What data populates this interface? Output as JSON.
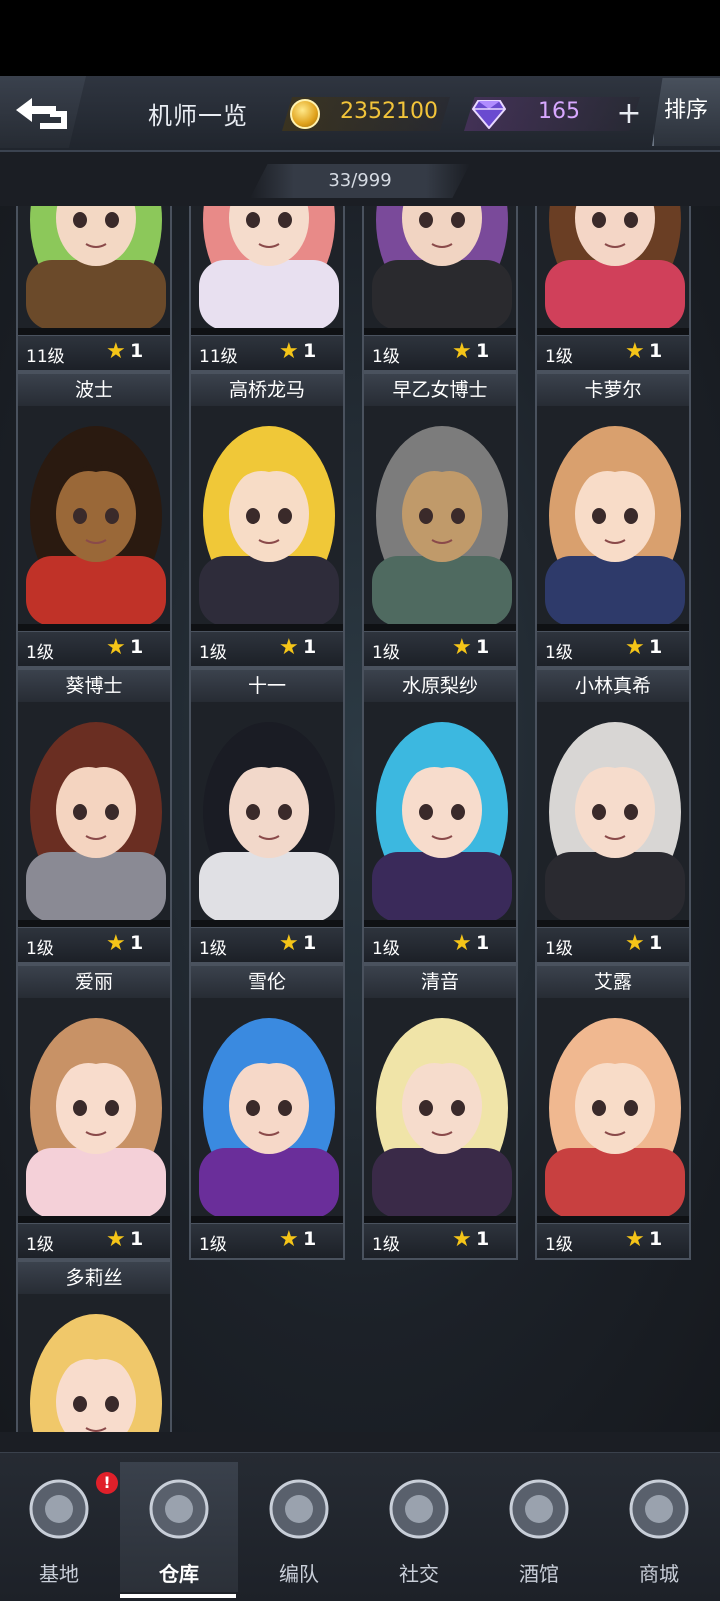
{
  "header": {
    "title": "机师一览",
    "coins": "2352100",
    "gems": "165",
    "plus": "+",
    "sort_label": "排序",
    "count": "33/999"
  },
  "cards": [
    {
      "name": "",
      "level": "11级",
      "stars": "1",
      "palette": [
        "#8cc85a",
        "#f3d8c4",
        "#6b4a2a"
      ]
    },
    {
      "name": "",
      "level": "11级",
      "stars": "1",
      "palette": [
        "#e88a88",
        "#f5dccc",
        "#e8e0f0"
      ]
    },
    {
      "name": "",
      "level": "1级",
      "stars": "1",
      "palette": [
        "#7a4a9a",
        "#f1d4c2",
        "#2a2a2e"
      ]
    },
    {
      "name": "",
      "level": "1级",
      "stars": "1",
      "palette": [
        "#6a3e24",
        "#f4d6c6",
        "#d0405a"
      ]
    },
    {
      "name": "波士",
      "level": "1级",
      "stars": "1",
      "palette": [
        "#2a1a10",
        "#9a6838",
        "#c03228"
      ]
    },
    {
      "name": "高桥龙马",
      "level": "1级",
      "stars": "1",
      "palette": [
        "#f0c838",
        "#f7dcc6",
        "#2e2c3a"
      ]
    },
    {
      "name": "早乙女博士",
      "level": "1级",
      "stars": "1",
      "palette": [
        "#7c7c7c",
        "#c09a6a",
        "#4f6a60"
      ]
    },
    {
      "name": "卡萝尔",
      "level": "1级",
      "stars": "1",
      "palette": [
        "#d9a06e",
        "#f8dcc8",
        "#2e3a6a"
      ]
    },
    {
      "name": "葵博士",
      "level": "1级",
      "stars": "1",
      "palette": [
        "#6a2e22",
        "#f4d4c0",
        "#8a8a94"
      ]
    },
    {
      "name": "十一",
      "level": "1级",
      "stars": "1",
      "palette": [
        "#1a1c24",
        "#f2d8ca",
        "#e0e0e4"
      ]
    },
    {
      "name": "水原梨纱",
      "level": "1级",
      "stars": "1",
      "palette": [
        "#3cb8e0",
        "#f7dccc",
        "#3a2a5a"
      ]
    },
    {
      "name": "小林真希",
      "level": "1级",
      "stars": "1",
      "palette": [
        "#d8d6d4",
        "#f6dccc",
        "#2a2a30"
      ]
    },
    {
      "name": "爱丽",
      "level": "1级",
      "stars": "1",
      "palette": [
        "#c89266",
        "#f8dccc",
        "#f4d0d8"
      ]
    },
    {
      "name": "雪伦",
      "level": "1级",
      "stars": "1",
      "palette": [
        "#3a8ae0",
        "#f6d8c8",
        "#6a2e9a"
      ]
    },
    {
      "name": "清音",
      "level": "1级",
      "stars": "1",
      "palette": [
        "#f0e4a8",
        "#f6dccc",
        "#3a2a48"
      ]
    },
    {
      "name": "艾露",
      "level": "1级",
      "stars": "1",
      "palette": [
        "#f0b890",
        "#f8dcc8",
        "#c84040"
      ]
    },
    {
      "name": "多莉丝",
      "level": "",
      "stars": "",
      "palette": [
        "#f0c86a",
        "#f8dccc",
        "#2a2420"
      ]
    }
  ],
  "nav": [
    {
      "label": "基地",
      "icon": "base-icon"
    },
    {
      "label": "仓库",
      "icon": "warehouse-icon"
    },
    {
      "label": "编队",
      "icon": "team-icon"
    },
    {
      "label": "社交",
      "icon": "social-icon"
    },
    {
      "label": "酒馆",
      "icon": "tavern-icon"
    },
    {
      "label": "商城",
      "icon": "shop-icon"
    }
  ],
  "badge": "!"
}
